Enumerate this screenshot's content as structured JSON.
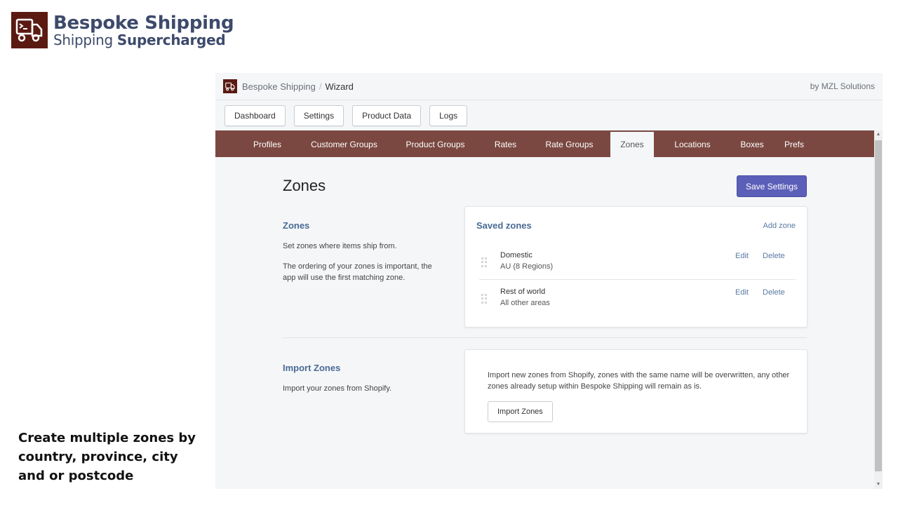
{
  "brand": {
    "title": "Bespoke Shipping",
    "subtitle_light": "Shipping ",
    "subtitle_bold": "Supercharged",
    "logo_icon": "truck-terminal-icon",
    "logo_color": "#5a1a12"
  },
  "caption": "Create multiple zones by country, province, city and or postcode",
  "app": {
    "breadcrumb": {
      "app": "Bespoke Shipping",
      "separator": "/",
      "page": "Wizard"
    },
    "byline": "by MZL Solutions",
    "top_buttons": [
      "Dashboard",
      "Settings",
      "Product Data",
      "Logs"
    ],
    "tabs": [
      {
        "label": "Profiles",
        "active": false
      },
      {
        "label": "Customer Groups",
        "active": false
      },
      {
        "label": "Product Groups",
        "active": false
      },
      {
        "label": "Rates",
        "active": false
      },
      {
        "label": "Rate Groups",
        "active": false
      },
      {
        "label": "Zones",
        "active": true
      },
      {
        "label": "Locations",
        "active": false
      },
      {
        "label": "Boxes",
        "active": false
      },
      {
        "label": "Prefs",
        "active": false
      }
    ],
    "tab_bar_color": "#7b4841",
    "page_title": "Zones",
    "save_button": "Save Settings",
    "accent_color": "#5c5fb8",
    "zones_section": {
      "title": "Zones",
      "text1": "Set zones where items ship from.",
      "text2": "The ordering of your zones is important, the app will use the first matching zone."
    },
    "saved_zones": {
      "title": "Saved zones",
      "add_label": "Add zone",
      "items": [
        {
          "name": "Domestic",
          "desc": "AU (8 Regions)",
          "edit": "Edit",
          "delete": "Delete"
        },
        {
          "name": "Rest of world",
          "desc": "All other areas",
          "edit": "Edit",
          "delete": "Delete"
        }
      ]
    },
    "import_section": {
      "title": "Import Zones",
      "text": "Import your zones from Shopify.",
      "card_text": "Import new zones from Shopify, zones with the same name will be overwritten, any other zones already setup within Bespoke Shipping will remain as is.",
      "button": "Import Zones"
    }
  }
}
